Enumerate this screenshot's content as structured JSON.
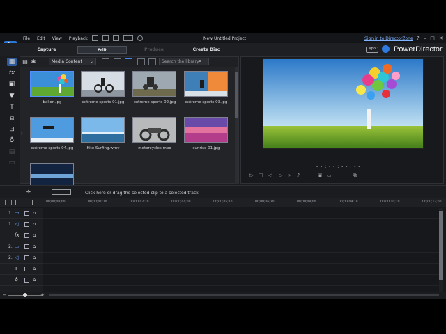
{
  "window": {
    "title": "New Untitled Project",
    "menu": [
      "File",
      "Edit",
      "View",
      "Playback"
    ],
    "signin": "Sign in to DirectorZone",
    "controls": [
      "?",
      "–",
      "□",
      "✕"
    ]
  },
  "modes": {
    "capture": "Capture",
    "edit": "Edit",
    "produce": "Produce",
    "create_disc": "Create Disc"
  },
  "brand": {
    "app_tag": "APP",
    "name": "PowerDirector"
  },
  "library": {
    "filter": "Media Content",
    "search_placeholder": "Search the library",
    "clips": [
      {
        "name": "ballon.jpg",
        "selected": true
      },
      {
        "name": "extreme sports 01.jpg",
        "selected": false
      },
      {
        "name": "extreme sports 02.jpg",
        "selected": false
      },
      {
        "name": "extreme sports 03.jpg",
        "selected": false
      },
      {
        "name": "extreme sports 04.jpg",
        "selected": false
      },
      {
        "name": "Kite Surfing.wmv",
        "selected": false
      },
      {
        "name": "motorcycles.mpo",
        "selected": false
      },
      {
        "name": "sunrise 01.jpg",
        "selected": false
      },
      {
        "name": "",
        "selected": false
      }
    ]
  },
  "preview": {
    "timecode": "- - : - - : - - : - -",
    "mode_3d": "3D"
  },
  "timeline": {
    "hint": "Click here or drag the selected clip to a selected track.",
    "ruler": [
      "00;00;00;00",
      "00;00;01;10",
      "00;00;02;20",
      "00;00;04;00",
      "00;00;05;10",
      "00;00;06;20",
      "00;00;08;00",
      "00;00;09;10",
      "00;00;10;20",
      "00;00;12;00"
    ],
    "tracks": [
      {
        "no": "1.",
        "icon": "video-track-icon"
      },
      {
        "no": "1.",
        "icon": "audio-track-icon"
      },
      {
        "no": "",
        "icon": "fx-track-icon"
      },
      {
        "no": "2.",
        "icon": "video-track-icon"
      },
      {
        "no": "2.",
        "icon": "audio-track-icon"
      },
      {
        "no": "",
        "icon": "title-track-icon"
      },
      {
        "no": "",
        "icon": "voice-track-icon"
      }
    ]
  },
  "colors": {
    "accent": "#3f86e6",
    "panel": "#232428",
    "background": "#1b1c1f"
  }
}
